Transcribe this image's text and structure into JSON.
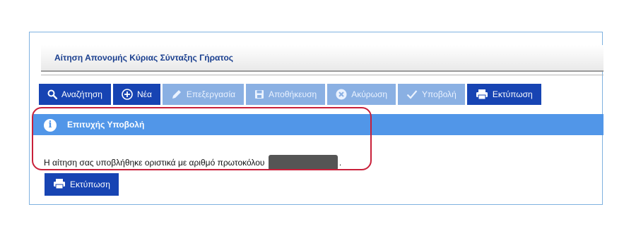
{
  "page": {
    "title": "Αίτηση Απονομής Κύριας Σύνταξης Γήρατος"
  },
  "toolbar": {
    "buttons": [
      {
        "label": "Αναζήτηση",
        "icon": "search-icon",
        "state": "active"
      },
      {
        "label": "Νέα",
        "icon": "plus-circle-icon",
        "state": "active"
      },
      {
        "label": "Επεξεργασία",
        "icon": "pencil-icon",
        "state": "disabled"
      },
      {
        "label": "Αποθήκευση",
        "icon": "floppy-disk-icon",
        "state": "disabled"
      },
      {
        "label": "Ακύρωση",
        "icon": "cancel-circle-icon",
        "state": "disabled"
      },
      {
        "label": "Υποβολή",
        "icon": "checkmark-icon",
        "state": "disabled"
      },
      {
        "label": "Εκτύπωση",
        "icon": "printer-icon",
        "state": "active"
      }
    ]
  },
  "alert": {
    "icon": "info-icon",
    "title": "Επιτυχής Υποβολή",
    "message": "Η αίτηση σας υποβλήθηκε οριστικά με αριθμό πρωτοκόλου"
  },
  "print_button": {
    "label": "Εκτύπωση",
    "icon": "printer-icon"
  },
  "colors": {
    "primary_button": "#1744b3",
    "disabled_button": "#8ab0e3",
    "alert_bar": "#5196e8",
    "highlight_outline": "#c9203a",
    "title_text": "#1a3f8f"
  }
}
